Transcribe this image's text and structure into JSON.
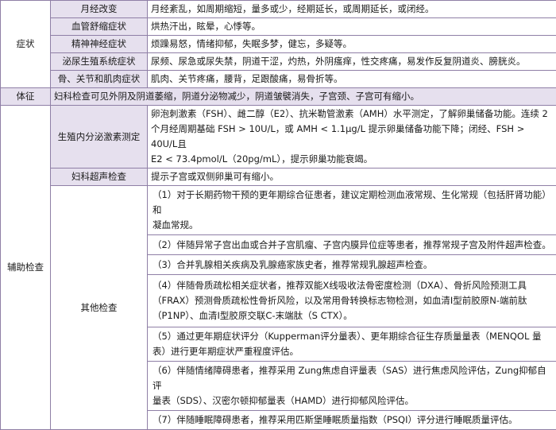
{
  "colors": {
    "border": "#8f7fa6",
    "highlight_band": "#e6e0ee"
  },
  "symptoms": {
    "category": "症状",
    "rows": [
      {
        "name": "月经改变",
        "desc": "月经紊乱，如周期缩短，量多或少，经期延长，或周期延长，或闭经。"
      },
      {
        "name": "血管舒缩症状",
        "desc": "烘热汗出，眩晕，心悸等。"
      },
      {
        "name": "精神神经症状",
        "desc": "烦躁易怒，情绪抑郁，失眠多梦，健忘，多疑等。"
      },
      {
        "name": "泌尿生殖系统症状",
        "desc": "尿频、尿急或尿失禁，阴道干涩，灼热，外阴瘙痒，性交疼痛，易发作反复阴道炎、膀胱炎。"
      },
      {
        "name": "骨、关节和肌肉症状",
        "desc": "肌肉、关节疼痛，腰背，足跟酸痛，易骨折等。"
      }
    ]
  },
  "signs": {
    "category": "体征",
    "desc": "妇科检查可见外阴及阴道萎缩，阴道分泌物减少，阴道皱襞消失，子宫颈、子宫可有缩小。"
  },
  "aux": {
    "category": "辅助检查",
    "endocrine": {
      "name": "生殖内分泌激素测定",
      "lines": [
        "卵泡刺激素（FSH）、雌二醇（E2）、抗米勒管激素（AMH）水平测定，了解卵巢储备功能。连续 2",
        "个月经周期基础 FSH > 10U/L，或 AMH < 1.1μg/L 提示卵巢储备功能下降；闭经、FSH > 40U/L且",
        "E2 < 73.4pmol/L（20pg/mL），提示卵巢功能衰竭。"
      ]
    },
    "ultrasound": {
      "name": "妇科超声检查",
      "desc": "提示子宫或双侧卵巢可有缩小。"
    },
    "other": {
      "name": "其他检查",
      "items": [
        {
          "lines": [
            "（1）对于长期药物干预的更年期综合征患者，建议定期检测血液常规、生化常规（包括肝肾功能）和",
            "凝血常规。"
          ]
        },
        {
          "lines": [
            "（2）伴随异常子宫出血或合并子宫肌瘤、子宫内膜异位症等患者，推荐常规子宫及附件超声检查。"
          ]
        },
        {
          "lines": [
            "（3）合并乳腺相关疾病及乳腺癌家族史者，推荐常规乳腺超声检查。"
          ]
        },
        {
          "lines": [
            "（4）伴随骨质疏松相关症状者，推荐双能X线吸收法骨密度检测（DXA）、骨折风险预测工具",
            "（FRAX）预测骨质疏松性骨折风险，以及常用骨转换标志物检测，如血清Ⅰ型前胶原N-端前肽",
            "（P1NP）、血清Ⅰ型胶原交联C-末端肽（S CTX）。"
          ]
        },
        {
          "lines": [
            "（5）通过更年期症状评分（Kupperman评分量表）、更年期综合征生存质量量表（MENQOL 量",
            "表）进行更年期症状严重程度评估。"
          ]
        },
        {
          "lines": [
            "（6）伴随情绪障碍患者，推荐采用 Zung焦虑自评量表（SAS）进行焦虑风险评估，Zung抑郁自评",
            "量表（SDS）、汉密尔顿抑郁量表（HAMD）进行抑郁风险评估。"
          ]
        },
        {
          "lines": [
            "（7）伴随睡眠障碍患者，推荐采用匹斯堡睡眠质量指数（PSQI）评分进行睡眠质量评估。"
          ]
        }
      ]
    }
  }
}
